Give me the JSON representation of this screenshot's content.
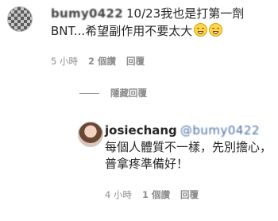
{
  "main_comment": {
    "username": "bumy0422",
    "text": "10/23我也是打第一劑BNT...希望副作用不要太大",
    "emojis": [
      "grinning-face-emoji",
      "grinning-face-emoji"
    ],
    "time": "5 小時",
    "likes": "2 個讚",
    "reply_label": "回覆"
  },
  "hidden_replies": {
    "label": "隱藏回覆"
  },
  "reply": {
    "username": "josiechang",
    "mention": "@bumy0422",
    "text": "每個人體質不一樣，先別擔心，普拿疼準備好！",
    "time": "4 小時",
    "likes": "1 個讚",
    "reply_label": "回覆"
  }
}
